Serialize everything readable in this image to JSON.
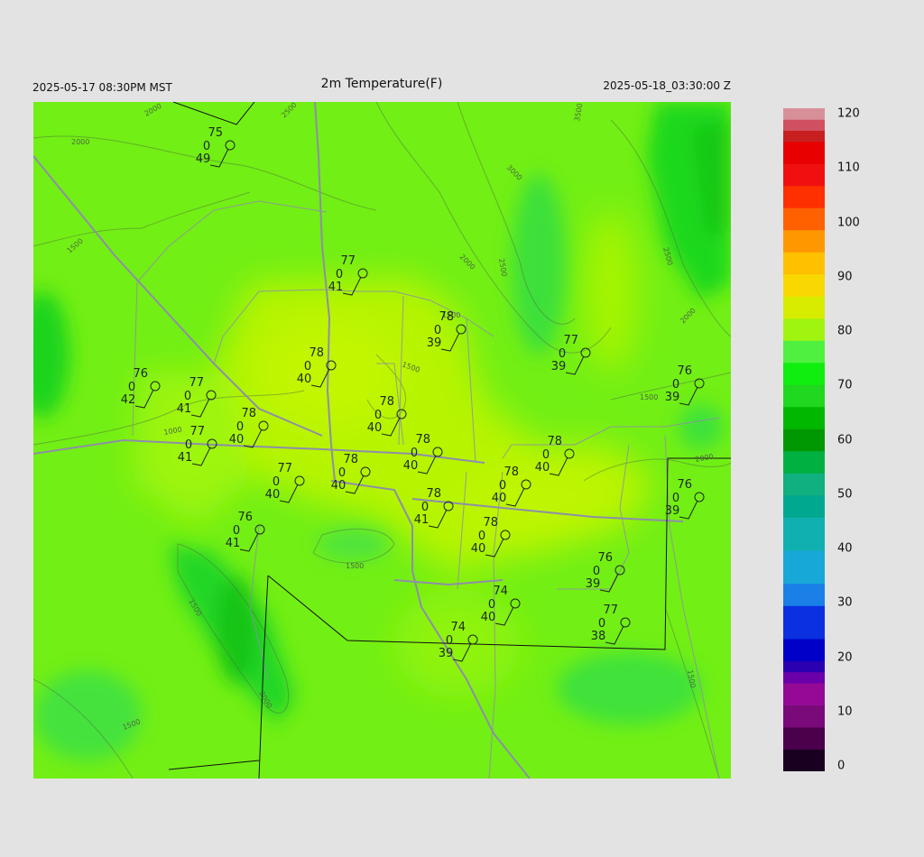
{
  "header": {
    "left": "2025-05-17 08:30PM MST",
    "title": "2m Temperature(F)",
    "right": "2025-05-18_03:30:00 Z"
  },
  "colors": {
    "background": "#e3e3e3",
    "field_base": "#6ef212",
    "field_warm": "#b8f500",
    "field_cool": "#32e832",
    "roads": "#8e8ea8",
    "boundaries": "#111111"
  },
  "contour_labels": [
    "2000",
    "2500",
    "2000",
    "3000",
    "3500",
    "2000",
    "2500",
    "2500",
    "2000",
    "1500",
    "1000",
    "1500",
    "1500",
    "1500",
    "1500",
    "1500",
    "2000",
    "1500",
    "1500",
    "2000"
  ],
  "colorbar": {
    "min": 0,
    "max": 120,
    "labels": [
      "120",
      "110",
      "100",
      "90",
      "80",
      "70",
      "60",
      "50",
      "40",
      "30",
      "20",
      "10",
      "0"
    ]
  },
  "stations": [
    {
      "temp": "75",
      "dew": "49",
      "wind": "0"
    },
    {
      "temp": "77",
      "dew": "41",
      "wind": "0"
    },
    {
      "temp": "78",
      "dew": "39",
      "wind": "0"
    },
    {
      "temp": "77",
      "dew": "39",
      "wind": "0"
    },
    {
      "temp": "78",
      "dew": "40",
      "wind": "0"
    },
    {
      "temp": "76",
      "dew": "42",
      "wind": "0"
    },
    {
      "temp": "77",
      "dew": "41",
      "wind": "0"
    },
    {
      "temp": "78",
      "dew": "40",
      "wind": "0"
    },
    {
      "temp": "77",
      "dew": "41",
      "wind": "0"
    },
    {
      "temp": "78",
      "dew": "40",
      "wind": "0"
    },
    {
      "temp": "76",
      "dew": "39",
      "wind": "0"
    },
    {
      "temp": "78",
      "dew": "40",
      "wind": "0"
    },
    {
      "temp": "78",
      "dew": "40",
      "wind": "0"
    },
    {
      "temp": "78",
      "dew": "40",
      "wind": "0"
    },
    {
      "temp": "77",
      "dew": "40",
      "wind": "0"
    },
    {
      "temp": "78",
      "dew": "40",
      "wind": "0"
    },
    {
      "temp": "76",
      "dew": "39",
      "wind": "0"
    },
    {
      "temp": "76",
      "dew": "41",
      "wind": "0"
    },
    {
      "temp": "78",
      "dew": "41",
      "wind": "0"
    },
    {
      "temp": "78",
      "dew": "40",
      "wind": "0"
    },
    {
      "temp": "76",
      "dew": "39",
      "wind": "0"
    },
    {
      "temp": "74",
      "dew": "40",
      "wind": "0"
    },
    {
      "temp": "77",
      "dew": "38",
      "wind": "0"
    },
    {
      "temp": "74",
      "dew": "39",
      "wind": "0"
    }
  ]
}
